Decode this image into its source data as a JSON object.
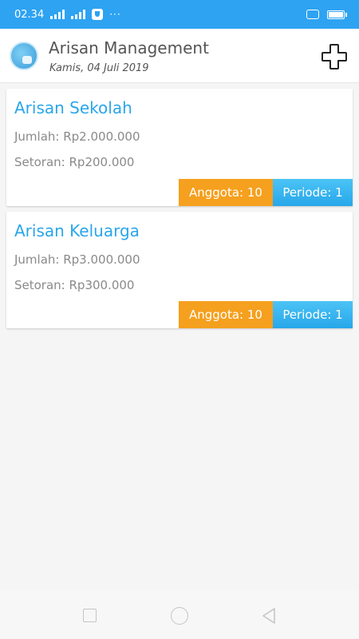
{
  "status_bar": {
    "time": "02.34",
    "dots": "···"
  },
  "header": {
    "title": "Arisan Management",
    "date": "Kamis, 04 Juli 2019",
    "logo_icon": "money-bag-icon",
    "add_icon": "plus-icon"
  },
  "cards": [
    {
      "title": "Arisan Sekolah",
      "jumlah": "Jumlah: Rp2.000.000",
      "setoran": "Setoran: Rp200.000",
      "anggota": "Anggota: 10",
      "periode": "Periode: 1"
    },
    {
      "title": "Arisan Keluarga",
      "jumlah": "Jumlah: Rp3.000.000",
      "setoran": "Setoran: Rp300.000",
      "anggota": "Anggota: 10",
      "periode": "Periode: 1"
    }
  ],
  "colors": {
    "status_bar": "#2ea3f2",
    "title_blue": "#29a6ea",
    "anggota_badge": "#f5a01e",
    "periode_badge": "#27a7ea"
  },
  "nav_icons": [
    "recent-apps-icon",
    "home-icon",
    "back-icon"
  ]
}
